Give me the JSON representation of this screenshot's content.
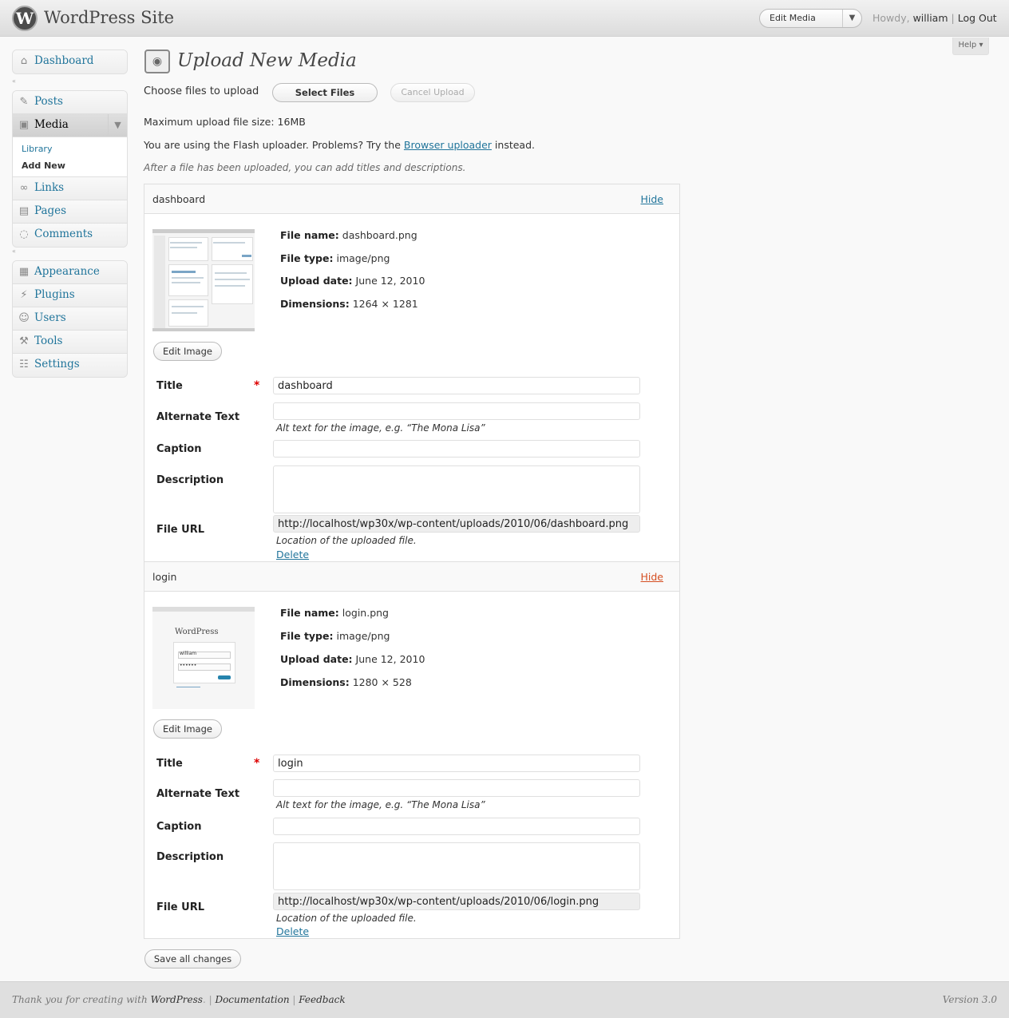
{
  "header": {
    "site_title": "WordPress Site",
    "favorite_action": "Edit Media",
    "howdy_prefix": "Howdy,",
    "username": "william",
    "separator": "|",
    "logout_label": "Log Out",
    "help_label": "Help"
  },
  "sidebar": {
    "group1": [
      {
        "label": "Dashboard",
        "icon": "house-icon"
      }
    ],
    "group2": [
      {
        "label": "Posts",
        "icon": "pushpin-icon"
      },
      {
        "label": "Media",
        "icon": "media-camera-icon"
      },
      {
        "label": "Links",
        "icon": "chain-link-icon"
      },
      {
        "label": "Pages",
        "icon": "pages-icon"
      },
      {
        "label": "Comments",
        "icon": "speech-bubble-icon"
      }
    ],
    "media_submenu": [
      "Library",
      "Add New"
    ],
    "group3": [
      {
        "label": "Appearance",
        "icon": "appearance-icon"
      },
      {
        "label": "Plugins",
        "icon": "plug-icon"
      },
      {
        "label": "Users",
        "icon": "users-icon"
      },
      {
        "label": "Tools",
        "icon": "tools-icon"
      },
      {
        "label": "Settings",
        "icon": "settings-icon"
      }
    ]
  },
  "main": {
    "page_title": "Upload New Media",
    "choose_label": "Choose files to upload",
    "select_files": "Select Files",
    "cancel_upload": "Cancel Upload",
    "max_size": "Maximum upload file size: 16MB",
    "flash_notice_pre": "You are using the Flash uploader. Problems? Try the",
    "flash_notice_link": "Browser uploader",
    "flash_notice_post": "instead.",
    "after_note": "After a file has been uploaded, you can add titles and descriptions.",
    "save_all": "Save all changes"
  },
  "labels": {
    "file_name": "File name:",
    "file_type": "File type:",
    "upload_date": "Upload date:",
    "dimensions": "Dimensions:",
    "edit_image": "Edit Image",
    "title": "Title",
    "required_mark": "*",
    "alt_text": "Alternate Text",
    "alt_help": "Alt text for the image, e.g. “The Mona Lisa”",
    "caption": "Caption",
    "description": "Description",
    "file_url": "File URL",
    "url_help": "Location of the uploaded file.",
    "delete": "Delete",
    "hide": "Hide"
  },
  "items": [
    {
      "filename": "dashboard",
      "file_name": "dashboard.png",
      "file_type": "image/png",
      "upload_date": "June 12, 2010",
      "dimensions": "1264 × 1281",
      "title_value": "dashboard",
      "url": "http://localhost/wp30x/wp-content/uploads/2010/06/dashboard.png",
      "hide_color": "#21759b"
    },
    {
      "filename": "login",
      "file_name": "login.png",
      "file_type": "image/png",
      "upload_date": "June 12, 2010",
      "dimensions": "1280 × 528",
      "title_value": "login",
      "url": "http://localhost/wp30x/wp-content/uploads/2010/06/login.png",
      "hide_color": "#d54e21"
    }
  ],
  "login_thumb": {
    "brand": "WordPress",
    "username": "william",
    "password_mask": "••••••"
  },
  "footer": {
    "thanks_pre": "Thank you for creating with",
    "thanks_link": "WordPress",
    "documentation": "Documentation",
    "feedback": "Feedback",
    "version": "Version 3.0"
  },
  "colors": {
    "link": "#21759b",
    "hide_hover": "#d54e21",
    "required": "#dd0000"
  }
}
